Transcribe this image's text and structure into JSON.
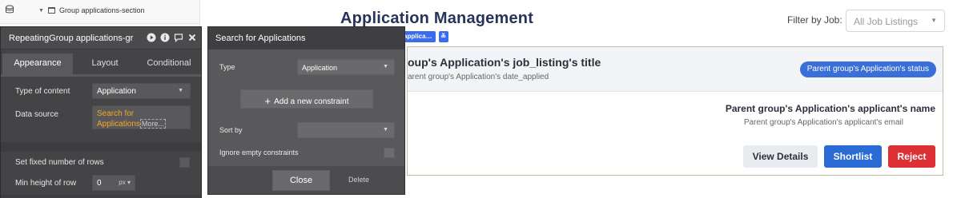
{
  "sidebar": {
    "tree_item": "Group applications-section"
  },
  "page": {
    "title": "Application Management",
    "filter_label": "Filter by Job:",
    "filter_value": "All Job Listings",
    "chips": [
      "applica…",
      "≚"
    ]
  },
  "card": {
    "job_title": "oup's Application's job_listing's title",
    "date_applied": "arent group's Application's date_applied",
    "status": "Parent group's Application's status",
    "applicant_name": "Parent group's Application's applicant's name",
    "applicant_email": "Parent group's Application's applicant's email",
    "buttons": {
      "view": "View Details",
      "shortlist": "Shortlist",
      "reject": "Reject"
    }
  },
  "prop_panel": {
    "title": "RepeatingGroup applications-gr",
    "tabs": [
      "Appearance",
      "Layout",
      "Conditional"
    ],
    "type_of_content_label": "Type of content",
    "type_of_content_value": "Application",
    "data_source_label": "Data source",
    "data_source_value_line1": "Search for",
    "data_source_value_line2": "Applications",
    "data_source_more": "More...",
    "fixed_rows_label": "Set fixed number of rows",
    "min_height_label": "Min height of row",
    "min_height_value": "0",
    "min_height_unit": "px"
  },
  "search_panel": {
    "title": "Search for Applications",
    "type_label": "Type",
    "type_value": "Application",
    "add_constraint": "Add a new constraint",
    "sort_by_label": "Sort by",
    "sort_by_value": "",
    "ignore_empty_label": "Ignore empty constraints",
    "close": "Close",
    "delete": "Delete"
  },
  "colors": {
    "title": "#26345a",
    "primary": "#2b6bd6",
    "danger": "#dc3034",
    "panel_dark": "#444446",
    "data_source_orange": "#f5a623"
  }
}
